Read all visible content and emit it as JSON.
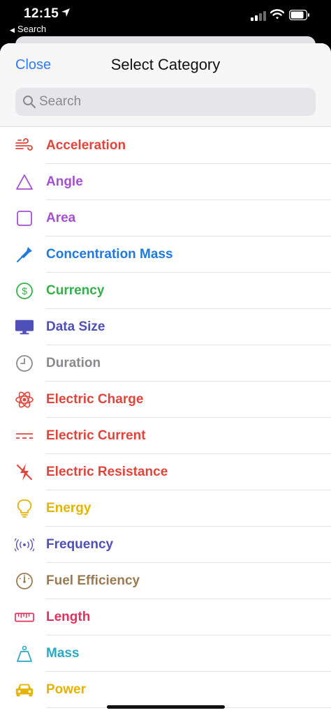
{
  "status": {
    "time": "12:15",
    "back_label": "Search"
  },
  "header": {
    "close_label": "Close",
    "title": "Select Category"
  },
  "search": {
    "placeholder": "Search"
  },
  "categories": [
    {
      "label": "Acceleration",
      "icon": "wind-icon",
      "color": "#e0443a"
    },
    {
      "label": "Angle",
      "icon": "triangle-icon",
      "color": "#a64fd1"
    },
    {
      "label": "Area",
      "icon": "square-icon",
      "color": "#a64fd1"
    },
    {
      "label": "Concentration Mass",
      "icon": "dropper-icon",
      "color": "#1f7ae0"
    },
    {
      "label": "Currency",
      "icon": "dollar-circle-icon",
      "color": "#34b04a"
    },
    {
      "label": "Data Size",
      "icon": "monitor-icon",
      "color": "#4f4fb8"
    },
    {
      "label": "Duration",
      "icon": "clock-icon",
      "color": "#8a8a8e"
    },
    {
      "label": "Electric Charge",
      "icon": "atom-icon",
      "color": "#e0443a"
    },
    {
      "label": "Electric Current",
      "icon": "dc-current-icon",
      "color": "#e0443a"
    },
    {
      "label": "Electric Resistance",
      "icon": "resistance-bolt-icon",
      "color": "#e0443a"
    },
    {
      "label": "Energy",
      "icon": "lightbulb-icon",
      "color": "#e5b400"
    },
    {
      "label": "Frequency",
      "icon": "broadcast-icon",
      "color": "#4f4fb8"
    },
    {
      "label": "Fuel Efficiency",
      "icon": "gauge-icon",
      "color": "#9a7a52"
    },
    {
      "label": "Length",
      "icon": "ruler-icon",
      "color": "#e0315f"
    },
    {
      "label": "Mass",
      "icon": "scale-weight-icon",
      "color": "#2aa8c4"
    },
    {
      "label": "Power",
      "icon": "car-icon",
      "color": "#e5b400"
    }
  ]
}
